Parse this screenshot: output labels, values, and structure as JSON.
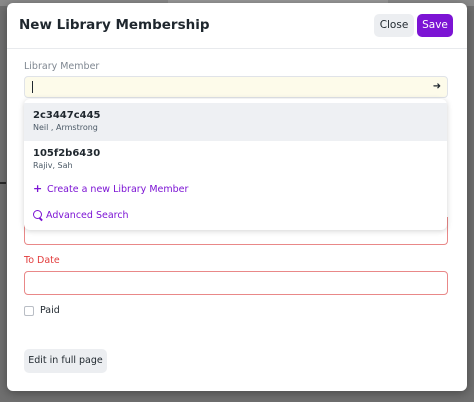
{
  "modal": {
    "title": "New Library Membership",
    "close_label": "Close",
    "save_label": "Save"
  },
  "form": {
    "library_member_label": "Library Member",
    "library_member_value": "",
    "to_date_label": "To Date",
    "paid_label": "Paid",
    "paid_checked": false,
    "edit_full_page_label": "Edit in full page"
  },
  "dropdown": {
    "options": [
      {
        "id": "2c3447c445",
        "name": "Neil , Armstrong"
      },
      {
        "id": "105f2b6430",
        "name": "Rajiv, Sah"
      }
    ],
    "create_label": "Create a new Library Member",
    "search_label": "Advanced Search"
  },
  "icons": {
    "link_arrow": "arrow-right-icon",
    "create": "plus-icon",
    "search": "search-icon"
  },
  "colors": {
    "accent": "#7c14d4",
    "error": "#e23c3c",
    "highlight_field": "#fdfbea"
  }
}
